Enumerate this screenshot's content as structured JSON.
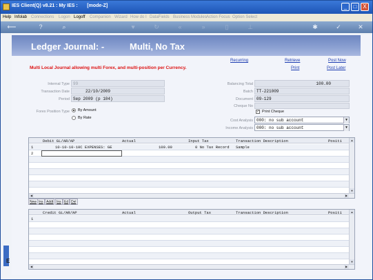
{
  "window": {
    "title": "IES Client(Q) v8.21 : My IES :       [mode-Z]",
    "minimize": "_",
    "maximize": "□",
    "close": "X"
  },
  "menu": [
    {
      "label": "Help",
      "dim": false
    },
    {
      "label": "Infolab",
      "dim": false
    },
    {
      "label": "Connections",
      "dim": true
    },
    {
      "label": "Logon",
      "dim": true
    },
    {
      "label": "Logoff",
      "dim": false
    },
    {
      "label": "Companion",
      "dim": true
    },
    {
      "label": "Wizard",
      "dim": true
    },
    {
      "label": "How do I",
      "dim": true
    },
    {
      "label": "DataFields",
      "dim": true
    },
    {
      "label": "Business Modules",
      "dim": true
    },
    {
      "label": "Action Focus",
      "dim": true
    },
    {
      "label": "Option Select",
      "dim": true
    }
  ],
  "toolbar": [
    "back-icon",
    "help-icon",
    "search-icon",
    "heart-icon",
    "refresh-icon",
    "rewind-icon",
    "forward-icon",
    "document-icon",
    "pin-icon",
    "gear-icon",
    "check-icon",
    "close-icon"
  ],
  "header": {
    "title_left": "Ledger Journal: -",
    "title_right": "Multi, No Tax",
    "links": {
      "recurring": "Recurring",
      "retrieve": "Retrieve",
      "post_now": "Post Now",
      "print": "Print",
      "post_later": "Post Later"
    },
    "message": "Multi Local Journal allowing multi Forex, and multi-position per Currency."
  },
  "form": {
    "internal_type": {
      "label": "Internal Type",
      "value": "99"
    },
    "transaction_date": {
      "label": "Transaction Date",
      "value": "22/10/2009"
    },
    "period": {
      "label": "Period",
      "value": "Sep 2009 (p 104)"
    },
    "forex_position_type": {
      "label": "Forex Position Type",
      "options": [
        "By Amount",
        "By Rate"
      ],
      "selected": "By Amount"
    },
    "balancing_total": {
      "label": "Balancing Total",
      "value": "100.00"
    },
    "batch": {
      "label": "Batch",
      "value": "TT-221009"
    },
    "document": {
      "label": "Document",
      "value": "09-129"
    },
    "cheque_no": {
      "label": "Cheque No",
      "value": ""
    },
    "print_cheque": {
      "label": "Print Cheque",
      "checked": true
    },
    "cost_analysis": {
      "label": "Cost Analysis",
      "value": "000: no sub account"
    },
    "income_analysis": {
      "label": "Income Analysis",
      "value": "000: no sub account"
    }
  },
  "debit_grid": {
    "columns": [
      "Debit GL/AR/AP",
      "Actual",
      "Input Tax",
      "Transaction Description",
      "Positi"
    ],
    "rows": [
      {
        "num": "1",
        "account": "10-10-10-10C EXPENSES: GE",
        "actual": "100.00",
        "tax": "0 No Tax Record",
        "description": "Sample"
      },
      {
        "num": "2",
        "account": "",
        "actual": "",
        "tax": "",
        "description": ""
      }
    ]
  },
  "grid_tabs": [
    "New",
    "Ins",
    "Addt",
    "Ins",
    "Ed",
    "Del"
  ],
  "credit_grid": {
    "columns": [
      "Credit GL/AR/AP",
      "Actual",
      "Output Tax",
      "Transaction Description",
      "Positi"
    ],
    "rows": [
      {
        "num": "1"
      }
    ]
  }
}
